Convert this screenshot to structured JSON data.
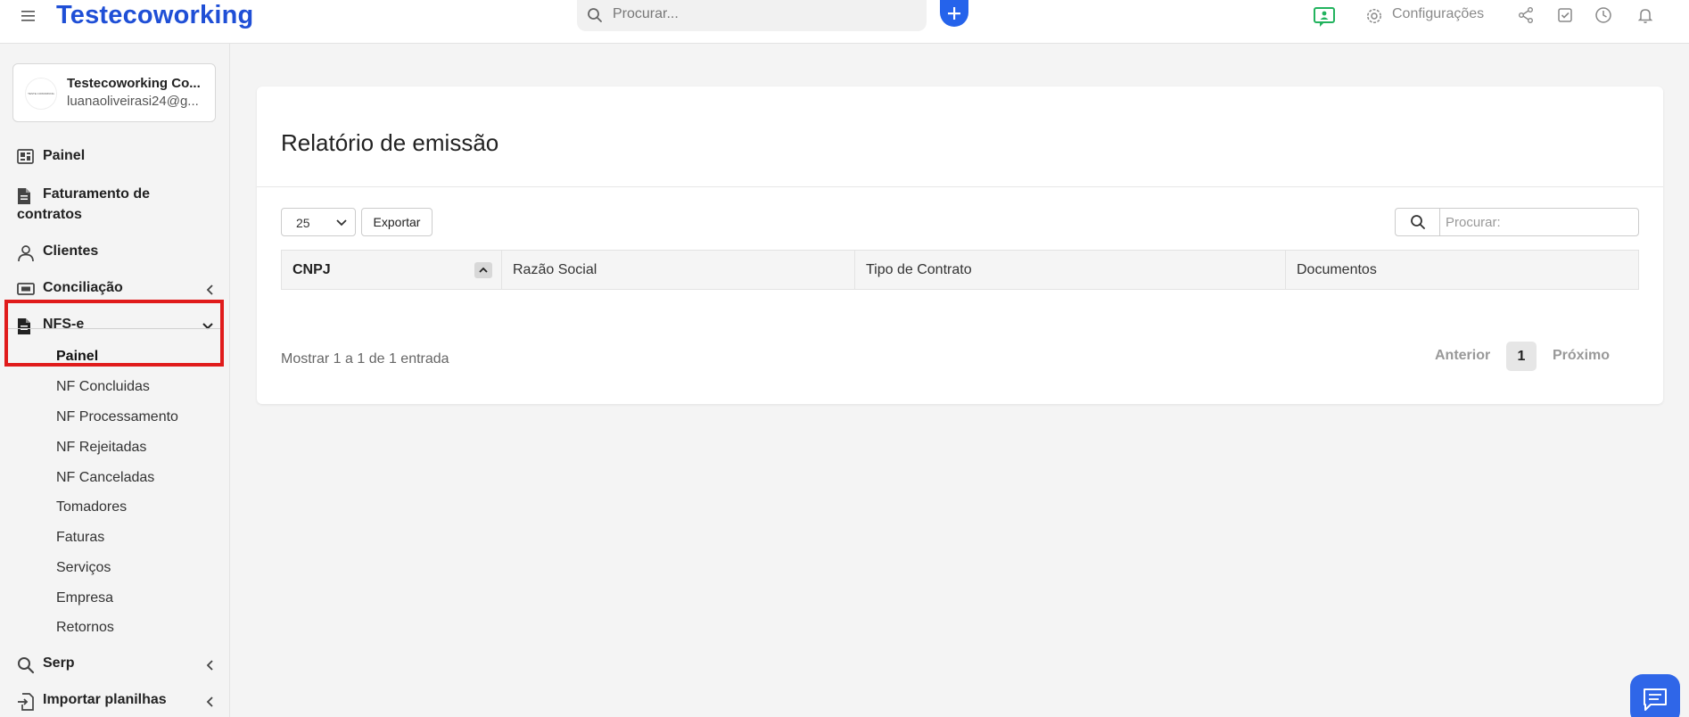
{
  "header": {
    "brand": "Testecoworking",
    "search_placeholder": "Procurar...",
    "config_label": "Configurações"
  },
  "sidebar": {
    "account": {
      "name": "Testecoworking Co...",
      "email": "luanaoliveirasi24@g...",
      "avatar_text": "TESTE COWORKING"
    },
    "items": [
      {
        "label": "Painel"
      },
      {
        "label": "Faturamento de",
        "label2": "contratos"
      },
      {
        "label": "Clientes"
      },
      {
        "label": "Conciliação"
      },
      {
        "label": "NFS-e"
      },
      {
        "label": "Serp"
      },
      {
        "label": "Importar planilhas"
      }
    ],
    "nfse_sub": [
      "Painel",
      "NF Concluidas",
      "NF Processamento",
      "NF Rejeitadas",
      "NF Canceladas",
      "Tomadores",
      "Faturas",
      "Serviços",
      "Empresa",
      "Retornos"
    ]
  },
  "main": {
    "title": "Relatório de emissão",
    "page_size": "25",
    "export_label": "Exportar",
    "search_placeholder": "Procurar:",
    "columns": [
      "CNPJ",
      "Razão Social",
      "Tipo de Contrato",
      "Documentos"
    ],
    "info": "Mostrar 1 a 1 de 1 entrada",
    "pagination": {
      "prev": "Anterior",
      "page": "1",
      "next": "Próximo"
    }
  },
  "colors": {
    "brand": "#1f4fd6",
    "accent": "#2563eb",
    "highlight": "#e01b1b",
    "green_icon": "#22b35e"
  }
}
